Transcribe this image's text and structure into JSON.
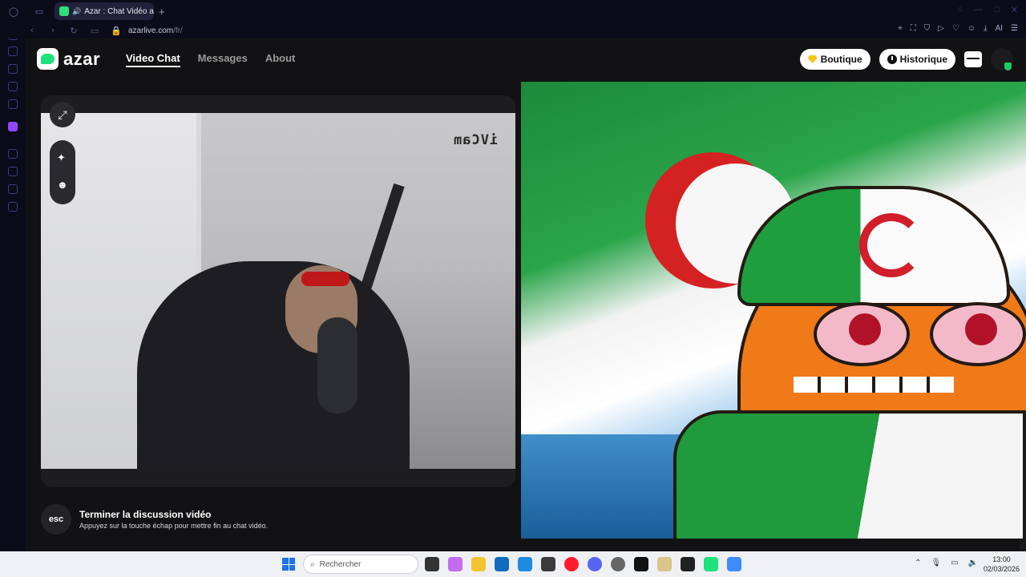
{
  "browser": {
    "tab_title": "Azar : Chat Vidéo avec",
    "url_host": "azarlive.com",
    "url_path": "/fr/",
    "ai_label": "AI"
  },
  "header": {
    "logo_text": "azar",
    "nav": [
      {
        "label": "Video Chat",
        "active": true
      },
      {
        "label": "Messages",
        "active": false
      },
      {
        "label": "About",
        "active": false
      }
    ],
    "shop_label": "Boutique",
    "history_label": "Historique"
  },
  "local_video": {
    "watermark": "iVCam"
  },
  "end_chat": {
    "key_label": "esc",
    "title": "Terminer la discussion vidéo",
    "hint": "Appuyez sur la touche échap pour mettre fin au chat vidéo."
  },
  "taskbar": {
    "search_placeholder": "Rechercher",
    "time": "13:00",
    "date": "02/03/2026"
  },
  "colors": {
    "accent_green": "#1ee27a",
    "page_bg": "#121214",
    "panel_bg": "#1d1d20"
  }
}
